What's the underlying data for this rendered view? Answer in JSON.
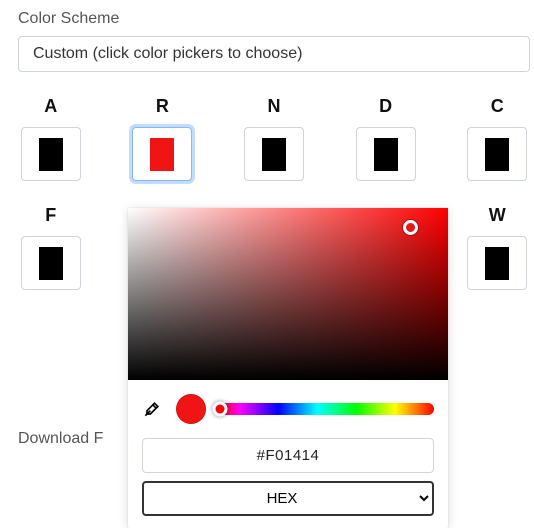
{
  "scheme_section_label": "Color Scheme",
  "scheme_select_value": "Custom (click color pickers to choose)",
  "swatches": [
    {
      "name": "A",
      "color": "#000000"
    },
    {
      "name": "R",
      "color": "#f01414"
    },
    {
      "name": "N",
      "color": "#000000"
    },
    {
      "name": "D",
      "color": "#000000"
    },
    {
      "name": "C",
      "color": "#000000"
    },
    {
      "name": "F",
      "color": "#000000"
    },
    {
      "name": "W",
      "color": "#000000"
    }
  ],
  "active_swatch": "R",
  "download_section_label": "Download F",
  "picker": {
    "hex_value": "#F01414",
    "format_value": "HEX",
    "preview_color": "#f01414",
    "hue_handle_color": "#ff0000"
  }
}
